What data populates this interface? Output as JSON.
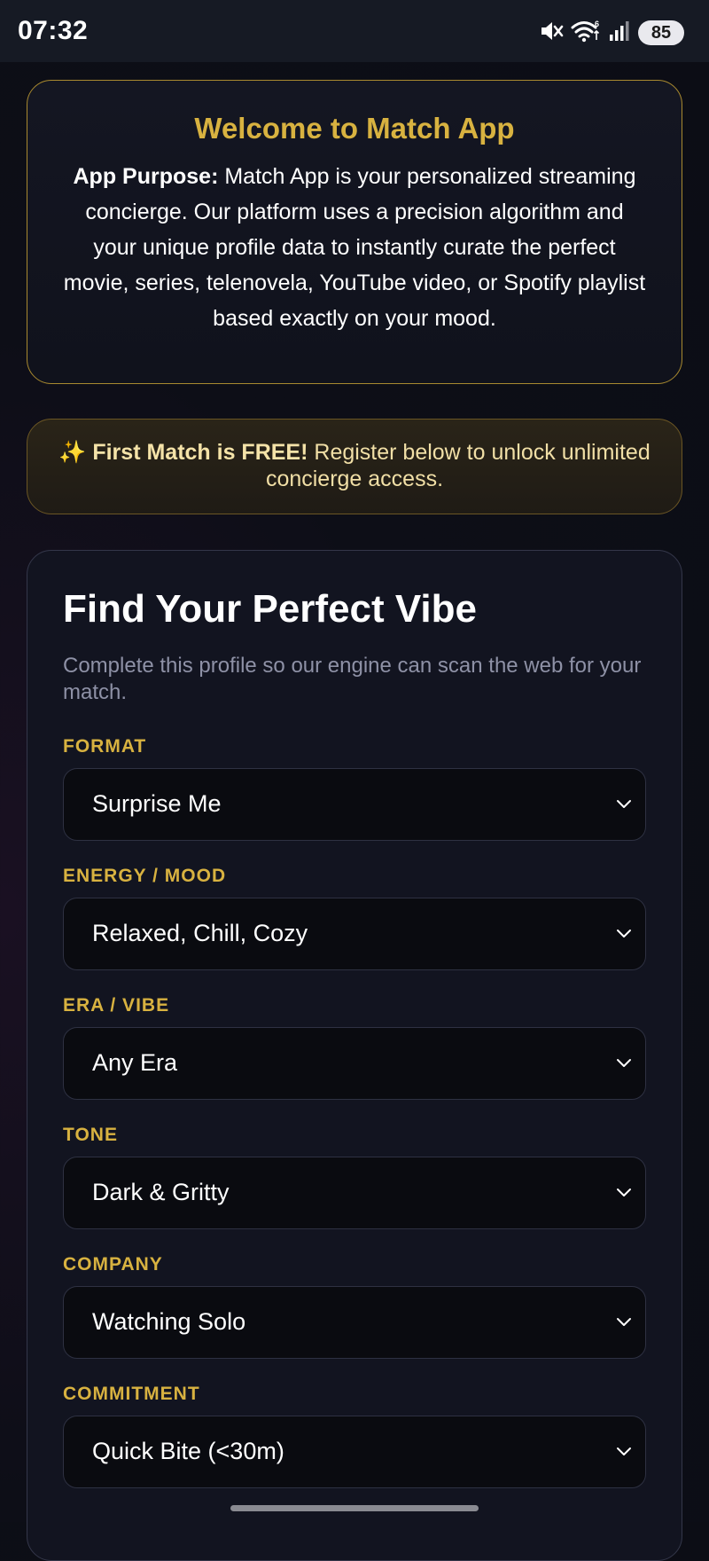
{
  "status_bar": {
    "time": "07:32",
    "battery": "85",
    "icons": [
      "mute-icon",
      "wifi-icon",
      "signal-icon"
    ]
  },
  "welcome": {
    "title": "Welcome to Match App",
    "purpose_label": "App Purpose:",
    "purpose_text": " Match App is your personalized streaming concierge. Our platform uses a precision algorithm and your unique profile data to instantly curate the perfect movie, series, telenovela, YouTube video, or Spotify playlist based exactly on your mood."
  },
  "promo": {
    "emoji": "✨",
    "highlight": "First Match is FREE!",
    "text": " Register below to unlock unlimited concierge access."
  },
  "form": {
    "title": "Find Your Perfect Vibe",
    "subtitle": "Complete this profile so our engine can scan the web for your match.",
    "fields": [
      {
        "label": "FORMAT",
        "value": "Surprise Me"
      },
      {
        "label": "ENERGY / MOOD",
        "value": "Relaxed, Chill, Cozy"
      },
      {
        "label": "ERA / VIBE",
        "value": "Any Era"
      },
      {
        "label": "TONE",
        "value": "Dark & Gritty"
      },
      {
        "label": "COMPANY",
        "value": "Watching Solo"
      },
      {
        "label": "COMMITMENT",
        "value": "Quick Bite (<30m)"
      }
    ]
  },
  "colors": {
    "accent_gold": "#d8b240",
    "background": "#0d0e17",
    "card": "#121420",
    "muted_text": "#8e91a6"
  }
}
